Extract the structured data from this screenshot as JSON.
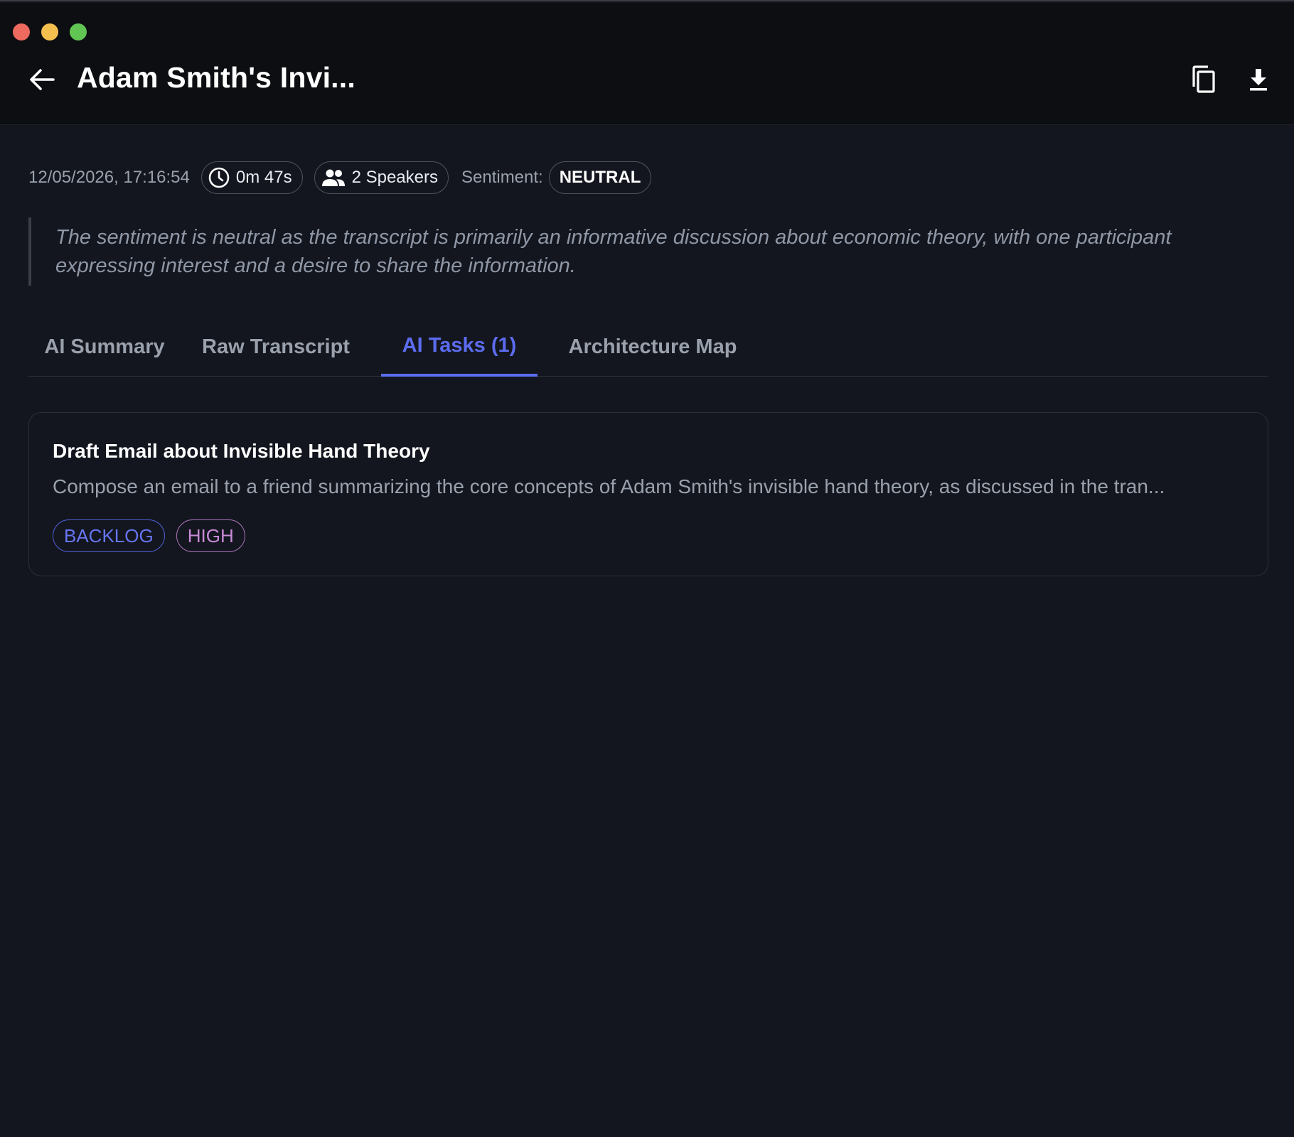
{
  "window": {
    "controls": [
      "close",
      "minimize",
      "maximize"
    ]
  },
  "header": {
    "title": "Adam Smith's Invi...",
    "back_icon": "arrow-left-icon",
    "copy_icon": "copy-icon",
    "download_icon": "download-icon"
  },
  "meta": {
    "date": "12/05/2026, 17:16:54",
    "duration": "0m 47s",
    "speakers": "2 Speakers",
    "sentiment_label": "Sentiment:",
    "sentiment_value": "NEUTRAL"
  },
  "sentiment_explanation": "The sentiment is neutral as the transcript is primarily an informative discussion about economic theory, with one participant expressing interest and a desire to share the information.",
  "tabs": [
    {
      "label": "AI Summary",
      "active": false
    },
    {
      "label": "Raw Transcript",
      "active": false
    },
    {
      "label": "AI Tasks (1)",
      "active": true
    },
    {
      "label": "Architecture Map",
      "active": false
    }
  ],
  "tasks": [
    {
      "title": "Draft Email about Invisible Hand Theory",
      "description": "Compose an email to a friend summarizing the core concepts of Adam Smith's invisible hand theory, as discussed in the tran...",
      "status": "BACKLOG",
      "priority": "HIGH"
    }
  ],
  "colors": {
    "accent": "#5b6cf0",
    "background": "#13161e",
    "header_background": "#0c0e12",
    "priority_high": "#c88ad6"
  }
}
